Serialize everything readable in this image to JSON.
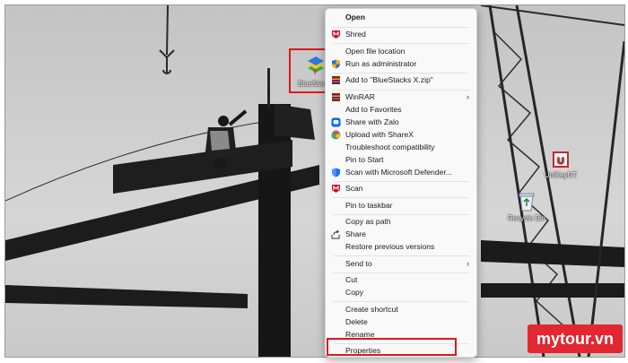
{
  "desktop": {
    "icons": [
      {
        "label": "BlueStacks",
        "icon": "bluestacks-icon"
      },
      {
        "label": "UniKeyNT",
        "icon": "unikey-icon"
      },
      {
        "label": "Recycle Bin",
        "icon": "recycle-bin-icon"
      }
    ]
  },
  "context_menu": {
    "items": [
      {
        "label": "Open",
        "icon": "",
        "bold": true
      },
      {
        "label": "Shred",
        "icon": "mcafee-icon"
      },
      {
        "label": "Open file location",
        "icon": ""
      },
      {
        "label": "Run as administrator",
        "icon": "shield-icon"
      },
      {
        "label": "Add to \"BlueStacks X.zip\"",
        "icon": "winrar-icon"
      },
      {
        "label": "WinRAR",
        "icon": "winrar-icon",
        "submenu": true
      },
      {
        "label": "Add to Favorites",
        "icon": ""
      },
      {
        "label": "Share with Zalo",
        "icon": "zalo-icon"
      },
      {
        "label": "Upload with ShareX",
        "icon": "sharex-icon"
      },
      {
        "label": "Troubleshoot compatibility",
        "icon": ""
      },
      {
        "label": "Pin to Start",
        "icon": ""
      },
      {
        "label": "Scan with Microsoft Defender...",
        "icon": "defender-icon"
      },
      {
        "label": "Scan",
        "icon": "mcafee-icon"
      },
      {
        "label": "Pin to taskbar",
        "icon": ""
      },
      {
        "label": "Copy as path",
        "icon": ""
      },
      {
        "label": "Share",
        "icon": "share-icon"
      },
      {
        "label": "Restore previous versions",
        "icon": ""
      },
      {
        "label": "Send to",
        "icon": "",
        "submenu": true
      },
      {
        "label": "Cut",
        "icon": ""
      },
      {
        "label": "Copy",
        "icon": ""
      },
      {
        "label": "Create shortcut",
        "icon": ""
      },
      {
        "label": "Delete",
        "icon": ""
      },
      {
        "label": "Rename",
        "icon": ""
      },
      {
        "label": "Properties",
        "icon": ""
      }
    ],
    "submenu_glyph": "›"
  },
  "watermark": {
    "text": "mytour.vn"
  },
  "colors": {
    "highlight": "#e0161f",
    "menu_bg": "#f9f9f9",
    "brand": "#e32730",
    "mcafee": "#c8102e",
    "winrar": "#8e1b1b",
    "zalo": "#0068ff",
    "defender": "#1f6feb"
  }
}
